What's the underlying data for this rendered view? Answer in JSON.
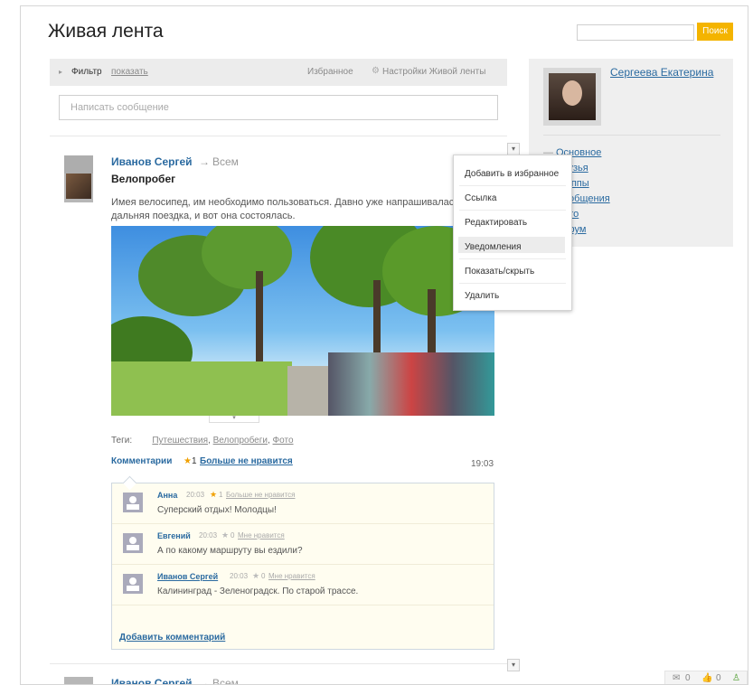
{
  "page": {
    "title": "Живая лента"
  },
  "search": {
    "button": "Поиск",
    "placeholder": ""
  },
  "filter": {
    "label": "Фильтр",
    "show_link": "показать",
    "favorites": "Избранное",
    "settings": "Настройки Живой ленты"
  },
  "composer": {
    "placeholder": "Написать сообщение"
  },
  "profile": {
    "name": "Сергеева Екатерина",
    "menu": [
      "Основное",
      "Друзья",
      "Группы",
      "Сообщения",
      "Фото",
      "Форум"
    ]
  },
  "post": {
    "author": "Иванов Сергей",
    "arrow": "→",
    "recipient": "Всем",
    "title": "Велопробег",
    "text": "Имея велосипед, им необходимо пользоваться. Давно уже напрашивалась",
    "text2": "дальняя поездка, и вот она состоялась.",
    "tags_label": "Теги:",
    "tags": [
      "Путешествия",
      "Велопробеги",
      "Фото"
    ],
    "comments_label": "Комментарии",
    "vote_count": "1",
    "like_link": "Больше не нравится",
    "time": "19:03",
    "dropdown_arrow": "▾",
    "photo_toggle": "▾"
  },
  "comments": [
    {
      "name": "Анна",
      "time": "20:03",
      "votes": "1",
      "like": "Больше не нравится",
      "text": "Суперский отдых! Молодцы!"
    },
    {
      "name": "Евгений",
      "time": "20:03",
      "votes": "0",
      "like": "Мне нравится",
      "text": "А по какому маршруту вы ездили?"
    },
    {
      "name": "Иванов Сергей",
      "time": "20:03",
      "votes": "0",
      "like": "Мне нравится",
      "text": "Калининград - Зеленоградск. По старой трассе."
    }
  ],
  "add_comment": "Добавить комментарий",
  "popup_menu": [
    "Добавить в избранное",
    "Ссылка",
    "Редактировать",
    "Уведомления",
    "Показать/скрыть",
    "Удалить"
  ],
  "post2": {
    "author": "Иванов Сергей",
    "arrow": "→",
    "recipient": "Всем",
    "dropdown_arrow": "▾"
  },
  "status_icons": {
    "messages": "0",
    "likes": "0"
  },
  "colors": {
    "accent": "#f4b400",
    "link": "#2a6aa0",
    "highlight": "#ececec"
  }
}
